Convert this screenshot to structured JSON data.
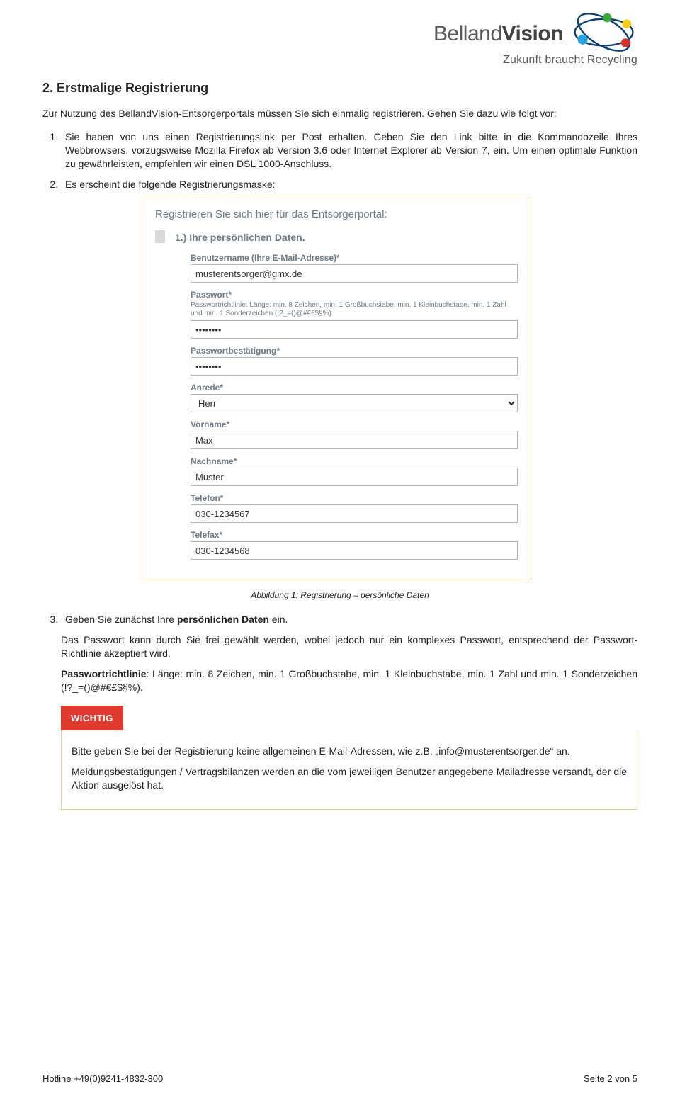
{
  "header": {
    "brand_a": "Belland",
    "brand_b": "Vision",
    "tagline": "Zukunft braucht Recycling"
  },
  "section": {
    "title": "2. Erstmalige Registrierung",
    "intro": "Zur Nutzung des BellandVision-Entsorgerportals müssen Sie sich einmalig registrieren. Gehen Sie dazu wie folgt vor:",
    "step1": "Sie haben von uns einen Registrierungslink per Post erhalten. Geben Sie den Link bitte in die Kommandozeile Ihres Webbrowsers, vorzugsweise Mozilla Firefox ab Version 3.6 oder Internet Explorer ab Version 7, ein. Um einen optimale Funktion zu gewährleisten, empfehlen wir einen DSL 1000-Anschluss.",
    "step2": "Es erscheint die folgende Registrierungsmaske:"
  },
  "form": {
    "title": "Registrieren Sie sich hier für das Entsorgerportal:",
    "section1_head": "1.) Ihre persönlichen Daten.",
    "fields": {
      "username_label": "Benutzername (Ihre E-Mail-Adresse)*",
      "username_value": "musterentsorger@gmx.de",
      "password_label": "Passwort*",
      "password_hint": "Passwortrichtlinie: Länge: min. 8 Zeichen, min. 1 Großbuchstabe, min. 1 Kleinbuchstabe, min. 1 Zahl und min. 1 Sonderzeichen (!?_=()@#€£$§%)",
      "password_value": "••••••••",
      "password_confirm_label": "Passwortbestätigung*",
      "password_confirm_value": "••••••••",
      "salutation_label": "Anrede*",
      "salutation_value": "Herr",
      "firstname_label": "Vorname*",
      "firstname_value": "Max",
      "lastname_label": "Nachname*",
      "lastname_value": "Muster",
      "phone_label": "Telefon*",
      "phone_value": "030-1234567",
      "fax_label": "Telefax*",
      "fax_value": "030-1234568"
    }
  },
  "caption": "Abbildung 1: Registrierung – persönliche Daten",
  "after": {
    "step3_lead": "Geben Sie zunächst Ihre ",
    "step3_bold": "persönlichen Daten",
    "step3_tail": " ein.",
    "p2": "Das Passwort kann durch Sie frei gewählt werden, wobei jedoch nur ein komplexes Passwort, entsprechend der Passwort-Richtlinie akzeptiert wird.",
    "rule_lead": "Passwortrichtlinie",
    "rule_tail": ": Länge: min. 8 Zeichen, min. 1 Großbuchstabe, min. 1 Kleinbuchstabe, min. 1 Zahl und min. 1 Sonderzeichen (!?_=()@#€£$§%).",
    "wichtig_label": "WICHTIG",
    "w1": "Bitte geben Sie bei der Registrierung keine allgemeinen E-Mail-Adressen, wie z.B. „info@musterentsorger.de“ an.",
    "w2": "Meldungsbestätigungen / Vertragsbilanzen werden an die vom jeweiligen Benutzer angegebene Mailadresse versandt, der die Aktion ausgelöst hat."
  },
  "footer": {
    "hotline": "Hotline +49(0)9241-4832-300",
    "page": "Seite 2 von 5"
  }
}
